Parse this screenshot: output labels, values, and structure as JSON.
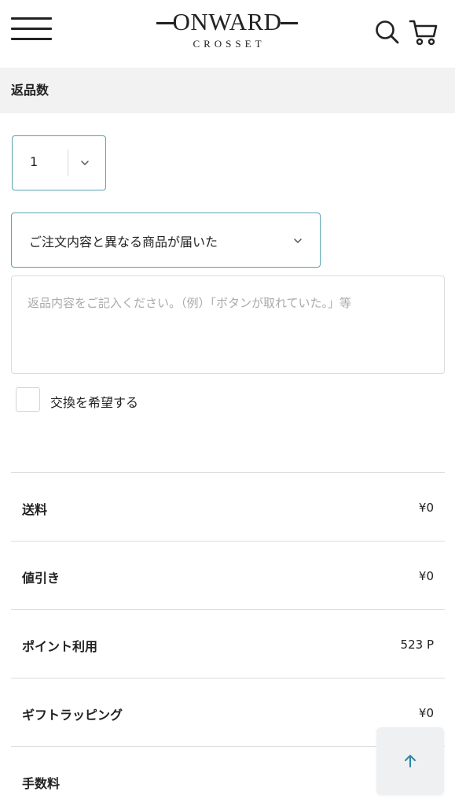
{
  "header": {
    "logo_main": "ONWARD",
    "logo_sub": "CROSSET"
  },
  "section": {
    "title": "返品数"
  },
  "form": {
    "quantity": "1",
    "reason": "ご注文内容と異なる商品が届いた",
    "detail_placeholder": "返品内容をご記入ください。（例）「ボタンが取れていた。」等",
    "exchange_label": "交換を希望する"
  },
  "summary": [
    {
      "label": "送料",
      "value": "¥0"
    },
    {
      "label": "値引き",
      "value": "¥0"
    },
    {
      "label": "ポイント利用",
      "value": "523 P"
    },
    {
      "label": "ギフトラッピング",
      "value": "¥0"
    },
    {
      "label": "手数料",
      "value": ""
    }
  ],
  "colors": {
    "accent_border": "#5aa3b2",
    "scroll_top_arrow": "#2f86a6",
    "section_bg": "#f2f2f2"
  },
  "icons": [
    "menu-icon",
    "search-icon",
    "cart-icon",
    "chevron-down-icon",
    "arrow-up-icon"
  ]
}
